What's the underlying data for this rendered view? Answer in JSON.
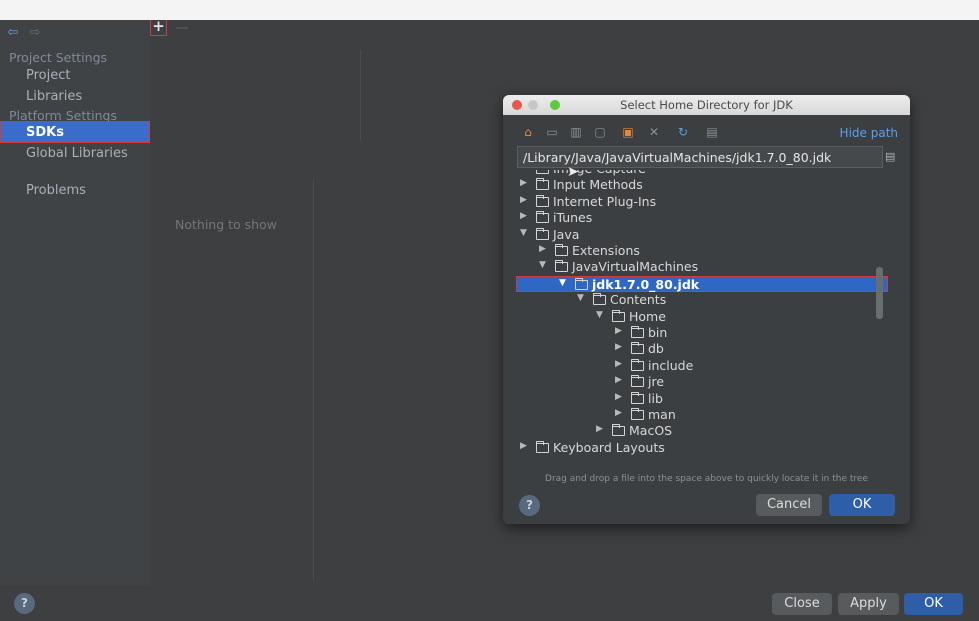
{
  "left_nav": {
    "back_icon": "arrow-left-icon",
    "forward_icon": "arrow-right-icon",
    "project_settings_header": "Project Settings",
    "project_label": "Project",
    "libraries_label": "Libraries",
    "platform_settings_header": "Platform Settings",
    "sdks_label": "SDKs",
    "global_libraries_label": "Global Libraries",
    "problems_label": "Problems"
  },
  "middle": {
    "add_label": "+",
    "remove_label": "—",
    "empty_text": "Nothing to show"
  },
  "bottom": {
    "help_label": "?",
    "close_label": "Close",
    "apply_label": "Apply",
    "ok_label": "OK"
  },
  "dialog": {
    "title": "Select Home Directory for JDK",
    "hide_path_label": "Hide path",
    "path_value": "/Library/Java/JavaVirtualMachines/jdk1.7.0_80.jdk",
    "toolbar_icons": [
      "home-icon",
      "desktop-icon",
      "project-icon",
      "module-icon",
      "new-folder-icon",
      "delete-icon",
      "refresh-icon",
      "show-hidden-icon"
    ],
    "tree": [
      {
        "label": "Image Capture",
        "depth": 0,
        "arrow": "▶"
      },
      {
        "label": "Input Methods",
        "depth": 0,
        "arrow": "▶"
      },
      {
        "label": "Internet Plug-Ins",
        "depth": 0,
        "arrow": "▶"
      },
      {
        "label": "iTunes",
        "depth": 0,
        "arrow": "▶"
      },
      {
        "label": "Java",
        "depth": 0,
        "arrow": "▼"
      },
      {
        "label": "Extensions",
        "depth": 1,
        "arrow": "▶"
      },
      {
        "label": "JavaVirtualMachines",
        "depth": 1,
        "arrow": "▼"
      },
      {
        "label": "jdk1.7.0_80.jdk",
        "depth": 2,
        "arrow": "▼",
        "selected": true
      },
      {
        "label": "Contents",
        "depth": 3,
        "arrow": "▼"
      },
      {
        "label": "Home",
        "depth": 4,
        "arrow": "▼"
      },
      {
        "label": "bin",
        "depth": 5,
        "arrow": "▶"
      },
      {
        "label": "db",
        "depth": 5,
        "arrow": "▶"
      },
      {
        "label": "include",
        "depth": 5,
        "arrow": "▶"
      },
      {
        "label": "jre",
        "depth": 5,
        "arrow": "▶"
      },
      {
        "label": "lib",
        "depth": 5,
        "arrow": "▶"
      },
      {
        "label": "man",
        "depth": 5,
        "arrow": "▶"
      },
      {
        "label": "MacOS",
        "depth": 4,
        "arrow": "▶"
      },
      {
        "label": "Keyboard Layouts",
        "depth": 0,
        "arrow": "▶"
      }
    ],
    "drag_hint": "Drag and drop a file into the space above to quickly locate it in the tree",
    "help_label": "?",
    "cancel_label": "Cancel",
    "ok_label": "OK"
  },
  "colors": {
    "window_bg": "#3e3f41",
    "nav_bg": "#404346",
    "selection": "#3a6dc9",
    "highlight_border": "#d33b3b",
    "link": "#5d9fe3"
  }
}
